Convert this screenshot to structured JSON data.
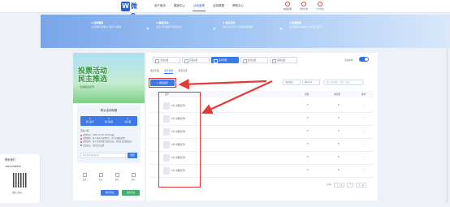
{
  "topnav": {
    "logo_letter": "W",
    "logo_text": "微8",
    "items": [
      "用户首页",
      "模板中心",
      "活动管理",
      "活动数据",
      "帮助中心"
    ],
    "active_index": 2,
    "tools": [
      "在线客服",
      "合作平台",
      "个人中心"
    ]
  },
  "banner": {
    "steps": [
      {
        "title": "1.选择模板",
        "desc": "从海量精美模板中 选择心仪模板"
      },
      {
        "title": "2.编辑活动",
        "desc": "自定义活动规则 和奖品信息"
      },
      {
        "title": "3.发布活动",
        "desc": "发布活动后分享 到朋友圈或群聊"
      },
      {
        "title": "4.查看数据",
        "desc": "实时查看活动数据 与用户参与情况"
      }
    ]
  },
  "preview": {
    "image_title": "投票活动",
    "image_title2": "民主推选",
    "image_sub": "活动报名进行中",
    "card_title": "默认活动标题",
    "stats": [
      {
        "value": "0",
        "label": "参与选手"
      },
      {
        "value": "0",
        "label": "累计投票"
      },
      {
        "value": "0",
        "label": "访问量"
      }
    ],
    "rule_label": "活动介绍",
    "lines": [
      "投票时间：2020-10-02 10:00开始",
      "投票规则：每人每天可投票3次，不可以重复投票",
      "投票说明：每个活动需填写真实信息，否则无法领取奖品",
      "活动奖品：请在后台设置"
    ],
    "input_placeholder": "输入选手编号/姓名",
    "search_btn": "搜索",
    "icons": [
      "首页",
      "排名",
      "报名",
      "我的"
    ],
    "actions": [
      "保存活动",
      "发布活动"
    ],
    "action_colors": [
      "#3d7ae8",
      "#3fb16d"
    ]
  },
  "contact": {
    "title": "联系我们",
    "phone": "18037288899",
    "caption": "客服二维码"
  },
  "main": {
    "templates": [
      "活动设置",
      "页面设置",
      "选手管理",
      "投票设置",
      "其他设置"
    ],
    "active_template": 2,
    "subtabs": [
      "选手列表",
      "选手审核",
      "投票记录"
    ],
    "new_btn": "+ 添加选手",
    "filter_label": "筛选：",
    "select1": "全部状态",
    "select2": "排序方式",
    "search_placeholder": "输入选手编号、姓名、标签",
    "headers": [
      "选手",
      "票数",
      "浏览量",
      "操作"
    ],
    "rows": [
      {
        "name": "2号  示例选手2",
        "votes": "0",
        "views": "0",
        "ops": "···"
      },
      {
        "name": "2号  示例选手5",
        "votes": "0",
        "views": "0",
        "ops": "···"
      },
      {
        "name": "2号  示例选手4",
        "votes": "0",
        "views": "0",
        "ops": "···"
      },
      {
        "name": "2号  示例选手1",
        "votes": "0",
        "views": "0",
        "ops": "···"
      },
      {
        "name": "2号  示例选手3",
        "votes": "0",
        "views": "0",
        "ops": "···"
      },
      {
        "name": "2号  示例选手1",
        "votes": "0",
        "views": "0",
        "ops": "···"
      }
    ],
    "pager": [
      "共6条",
      "上一页",
      "1",
      "下一页"
    ],
    "toggle_label": "活动启用"
  }
}
